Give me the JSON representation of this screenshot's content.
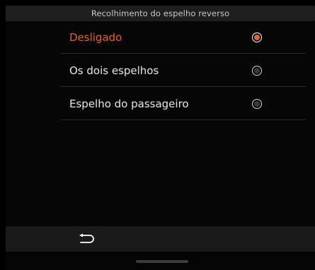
{
  "header": {
    "title": "Recolhimento do espelho reverso"
  },
  "options": [
    {
      "label": "Desligado",
      "selected": true
    },
    {
      "label": "Os dois espelhos",
      "selected": false
    },
    {
      "label": "Espelho do passageiro",
      "selected": false
    }
  ],
  "footer": {
    "back_icon": "back-arrow-icon"
  },
  "colors": {
    "accent": "#e8622a",
    "text": "#e6e6e6",
    "header_bg": "#1e1e1e",
    "background": "#000000"
  }
}
